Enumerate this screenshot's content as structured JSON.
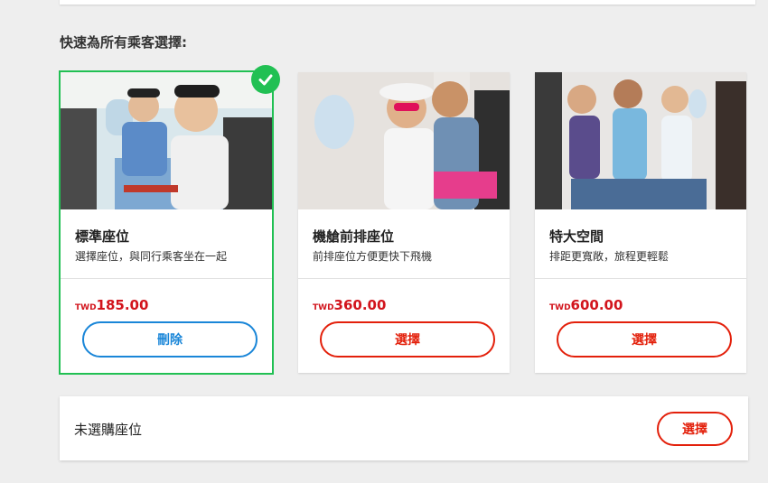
{
  "section": {
    "title": "快速為所有乘客選擇:"
  },
  "cards": [
    {
      "name": "標準座位",
      "desc": "選擇座位，與同行乘客坐在一起",
      "currency": "TWD",
      "amount": "185.00",
      "button": "刪除",
      "selected": true,
      "image": "photo-two-men-selfie"
    },
    {
      "name": "機艙前排座位",
      "desc": "前排座位方便更快下飛機",
      "currency": "TWD",
      "amount": "360.00",
      "button": "選擇",
      "selected": false,
      "image": "photo-two-women-selfie"
    },
    {
      "name": "特大空間",
      "desc": "排距更寬敞，旅程更輕鬆",
      "currency": "TWD",
      "amount": "600.00",
      "button": "選擇",
      "selected": false,
      "image": "photo-three-women-seated"
    }
  ],
  "no_seat": {
    "label": "未選購座位",
    "button": "選擇"
  },
  "colors": {
    "accent_red": "#e3200b",
    "accent_blue": "#1a86d8",
    "selected_green": "#21c053"
  }
}
